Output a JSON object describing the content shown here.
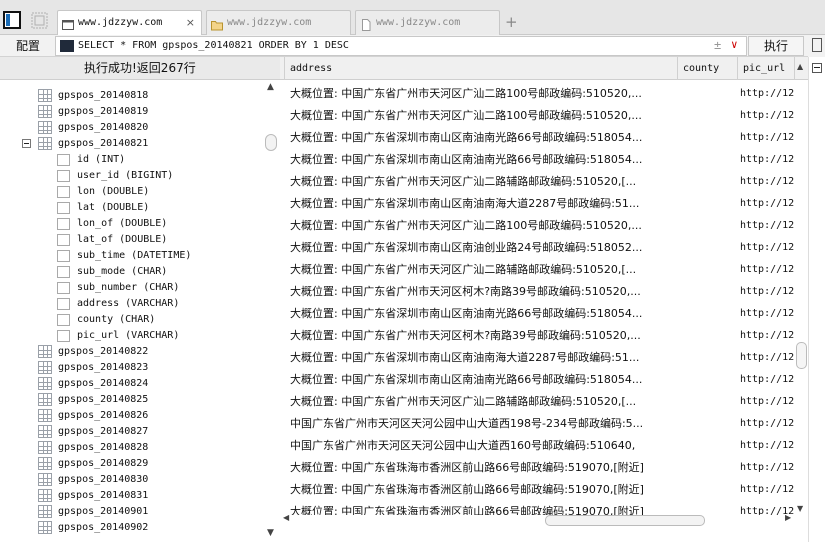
{
  "tabs": [
    {
      "label": "www.jdzzyw.com",
      "active": true,
      "icon": "browser-page-icon"
    },
    {
      "label": "www.jdzzyw.com",
      "active": false,
      "icon": "folder-icon"
    },
    {
      "label": "www.jdzzyw.com",
      "active": false,
      "icon": "document-icon"
    }
  ],
  "new_tab": "+",
  "query": {
    "config_label": "配置",
    "sql": "SELECT * FROM gpspos_20140821 ORDER BY 1 DESC",
    "plus_minus": "±",
    "dropdown": "∨",
    "run_label": "执行"
  },
  "status_text": "执行成功!返回267行",
  "tree": [
    {
      "kind": "table",
      "label": "gpspos_20140818"
    },
    {
      "kind": "table",
      "label": "gpspos_20140819"
    },
    {
      "kind": "table",
      "label": "gpspos_20140820"
    },
    {
      "kind": "table-open",
      "label": "gpspos_20140821"
    },
    {
      "kind": "column",
      "label": "id (INT)"
    },
    {
      "kind": "column",
      "label": "user_id (BIGINT)"
    },
    {
      "kind": "column",
      "label": "lon (DOUBLE)"
    },
    {
      "kind": "column",
      "label": "lat (DOUBLE)"
    },
    {
      "kind": "column",
      "label": "lon_of (DOUBLE)"
    },
    {
      "kind": "column",
      "label": "lat_of (DOUBLE)"
    },
    {
      "kind": "column",
      "label": "sub_time (DATETIME)"
    },
    {
      "kind": "column",
      "label": "sub_mode (CHAR)"
    },
    {
      "kind": "column",
      "label": "sub_number (CHAR)"
    },
    {
      "kind": "column",
      "label": "address (VARCHAR)"
    },
    {
      "kind": "column",
      "label": "county (CHAR)"
    },
    {
      "kind": "column",
      "label": "pic_url (VARCHAR)"
    },
    {
      "kind": "table",
      "label": "gpspos_20140822"
    },
    {
      "kind": "table",
      "label": "gpspos_20140823"
    },
    {
      "kind": "table",
      "label": "gpspos_20140824"
    },
    {
      "kind": "table",
      "label": "gpspos_20140825"
    },
    {
      "kind": "table",
      "label": "gpspos_20140826"
    },
    {
      "kind": "table",
      "label": "gpspos_20140827"
    },
    {
      "kind": "table",
      "label": "gpspos_20140828"
    },
    {
      "kind": "table",
      "label": "gpspos_20140829"
    },
    {
      "kind": "table",
      "label": "gpspos_20140830"
    },
    {
      "kind": "table",
      "label": "gpspos_20140831"
    },
    {
      "kind": "table",
      "label": "gpspos_20140901"
    },
    {
      "kind": "table",
      "label": "gpspos_20140902"
    }
  ],
  "columns": [
    "address",
    "county",
    "pic_url"
  ],
  "rows": [
    {
      "address": "大概位置: 中国广东省广州市天河区广汕二路100号邮政编码:510520,...",
      "pic_url": "http://12"
    },
    {
      "address": "大概位置: 中国广东省广州市天河区广汕二路100号邮政编码:510520,...",
      "pic_url": "http://12"
    },
    {
      "address": "大概位置: 中国广东省深圳市南山区南油南光路66号邮政编码:518054...",
      "pic_url": "http://12"
    },
    {
      "address": "大概位置: 中国广东省深圳市南山区南油南光路66号邮政编码:518054...",
      "pic_url": "http://12"
    },
    {
      "address": "大概位置: 中国广东省广州市天河区广汕二路辅路邮政编码:510520,[...",
      "pic_url": "http://12"
    },
    {
      "address": "大概位置: 中国广东省深圳市南山区南油南海大道2287号邮政编码:51...",
      "pic_url": "http://12"
    },
    {
      "address": "大概位置: 中国广东省广州市天河区广汕二路100号邮政编码:510520,...",
      "pic_url": "http://12"
    },
    {
      "address": "大概位置: 中国广东省深圳市南山区南油创业路24号邮政编码:518052...",
      "pic_url": "http://12"
    },
    {
      "address": "大概位置: 中国广东省广州市天河区广汕二路辅路邮政编码:510520,[...",
      "pic_url": "http://12"
    },
    {
      "address": "大概位置: 中国广东省广州市天河区柯木?南路39号邮政编码:510520,...",
      "pic_url": "http://12"
    },
    {
      "address": "大概位置: 中国广东省深圳市南山区南油南光路66号邮政编码:518054...",
      "pic_url": "http://12"
    },
    {
      "address": "大概位置: 中国广东省广州市天河区柯木?南路39号邮政编码:510520,...",
      "pic_url": "http://12"
    },
    {
      "address": "大概位置: 中国广东省深圳市南山区南油南海大道2287号邮政编码:51...",
      "pic_url": "http://12"
    },
    {
      "address": "大概位置: 中国广东省深圳市南山区南油南光路66号邮政编码:518054...",
      "pic_url": "http://12"
    },
    {
      "address": "大概位置: 中国广东省广州市天河区广汕二路辅路邮政编码:510520,[...",
      "pic_url": "http://12"
    },
    {
      "address": "中国广东省广州市天河区天河公园中山大道西198号-234号邮政编码:5...",
      "pic_url": "http://12"
    },
    {
      "address": "中国广东省广州市天河区天河公园中山大道西160号邮政编码:510640,",
      "pic_url": "http://12"
    },
    {
      "address": "大概位置: 中国广东省珠海市香洲区前山路66号邮政编码:519070,[附近]",
      "pic_url": "http://12"
    },
    {
      "address": "大概位置: 中国广东省珠海市香洲区前山路66号邮政编码:519070,[附近]",
      "pic_url": "http://12"
    },
    {
      "address": "大概位置: 中国广东省珠海市香洲区前山路66号邮政编码:519070,[附近]",
      "pic_url": "http://12"
    }
  ]
}
